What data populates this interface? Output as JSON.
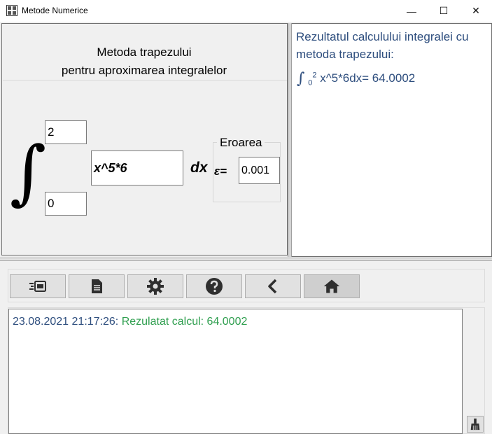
{
  "window": {
    "title": "Metode Numerice",
    "minimize_glyph": "—",
    "maximize_glyph": "☐",
    "close_glyph": "✕"
  },
  "panel": {
    "title_line1": "Metoda trapezului",
    "title_line2": "pentru aproximarea integralelor",
    "integral_symbol": "∫",
    "upper_limit": "2",
    "lower_limit": "0",
    "function": "x^5*6",
    "dx_label": "dx",
    "error_group_title": "Eroarea",
    "epsilon_label": "ε=",
    "error_value": "0.001"
  },
  "result": {
    "title": "Rezultatul calculului integralei cu metoda trapezului:",
    "integral_symbol": "∫",
    "lower": "0",
    "upper": "2",
    "expression": "x^5*6dx= 64.0002"
  },
  "toolbar": {
    "buttons": [
      {
        "name": "run-icon"
      },
      {
        "name": "document-icon"
      },
      {
        "name": "gear-icon"
      },
      {
        "name": "help-icon"
      },
      {
        "name": "back-icon"
      },
      {
        "name": "home-icon"
      }
    ]
  },
  "log": {
    "timestamp": "23.08.2021 21:17:26: ",
    "message": "Rezulatat calcul: 64.0002"
  },
  "colors": {
    "result_text": "#2e4e7e",
    "log_message": "#2e9e4e"
  }
}
